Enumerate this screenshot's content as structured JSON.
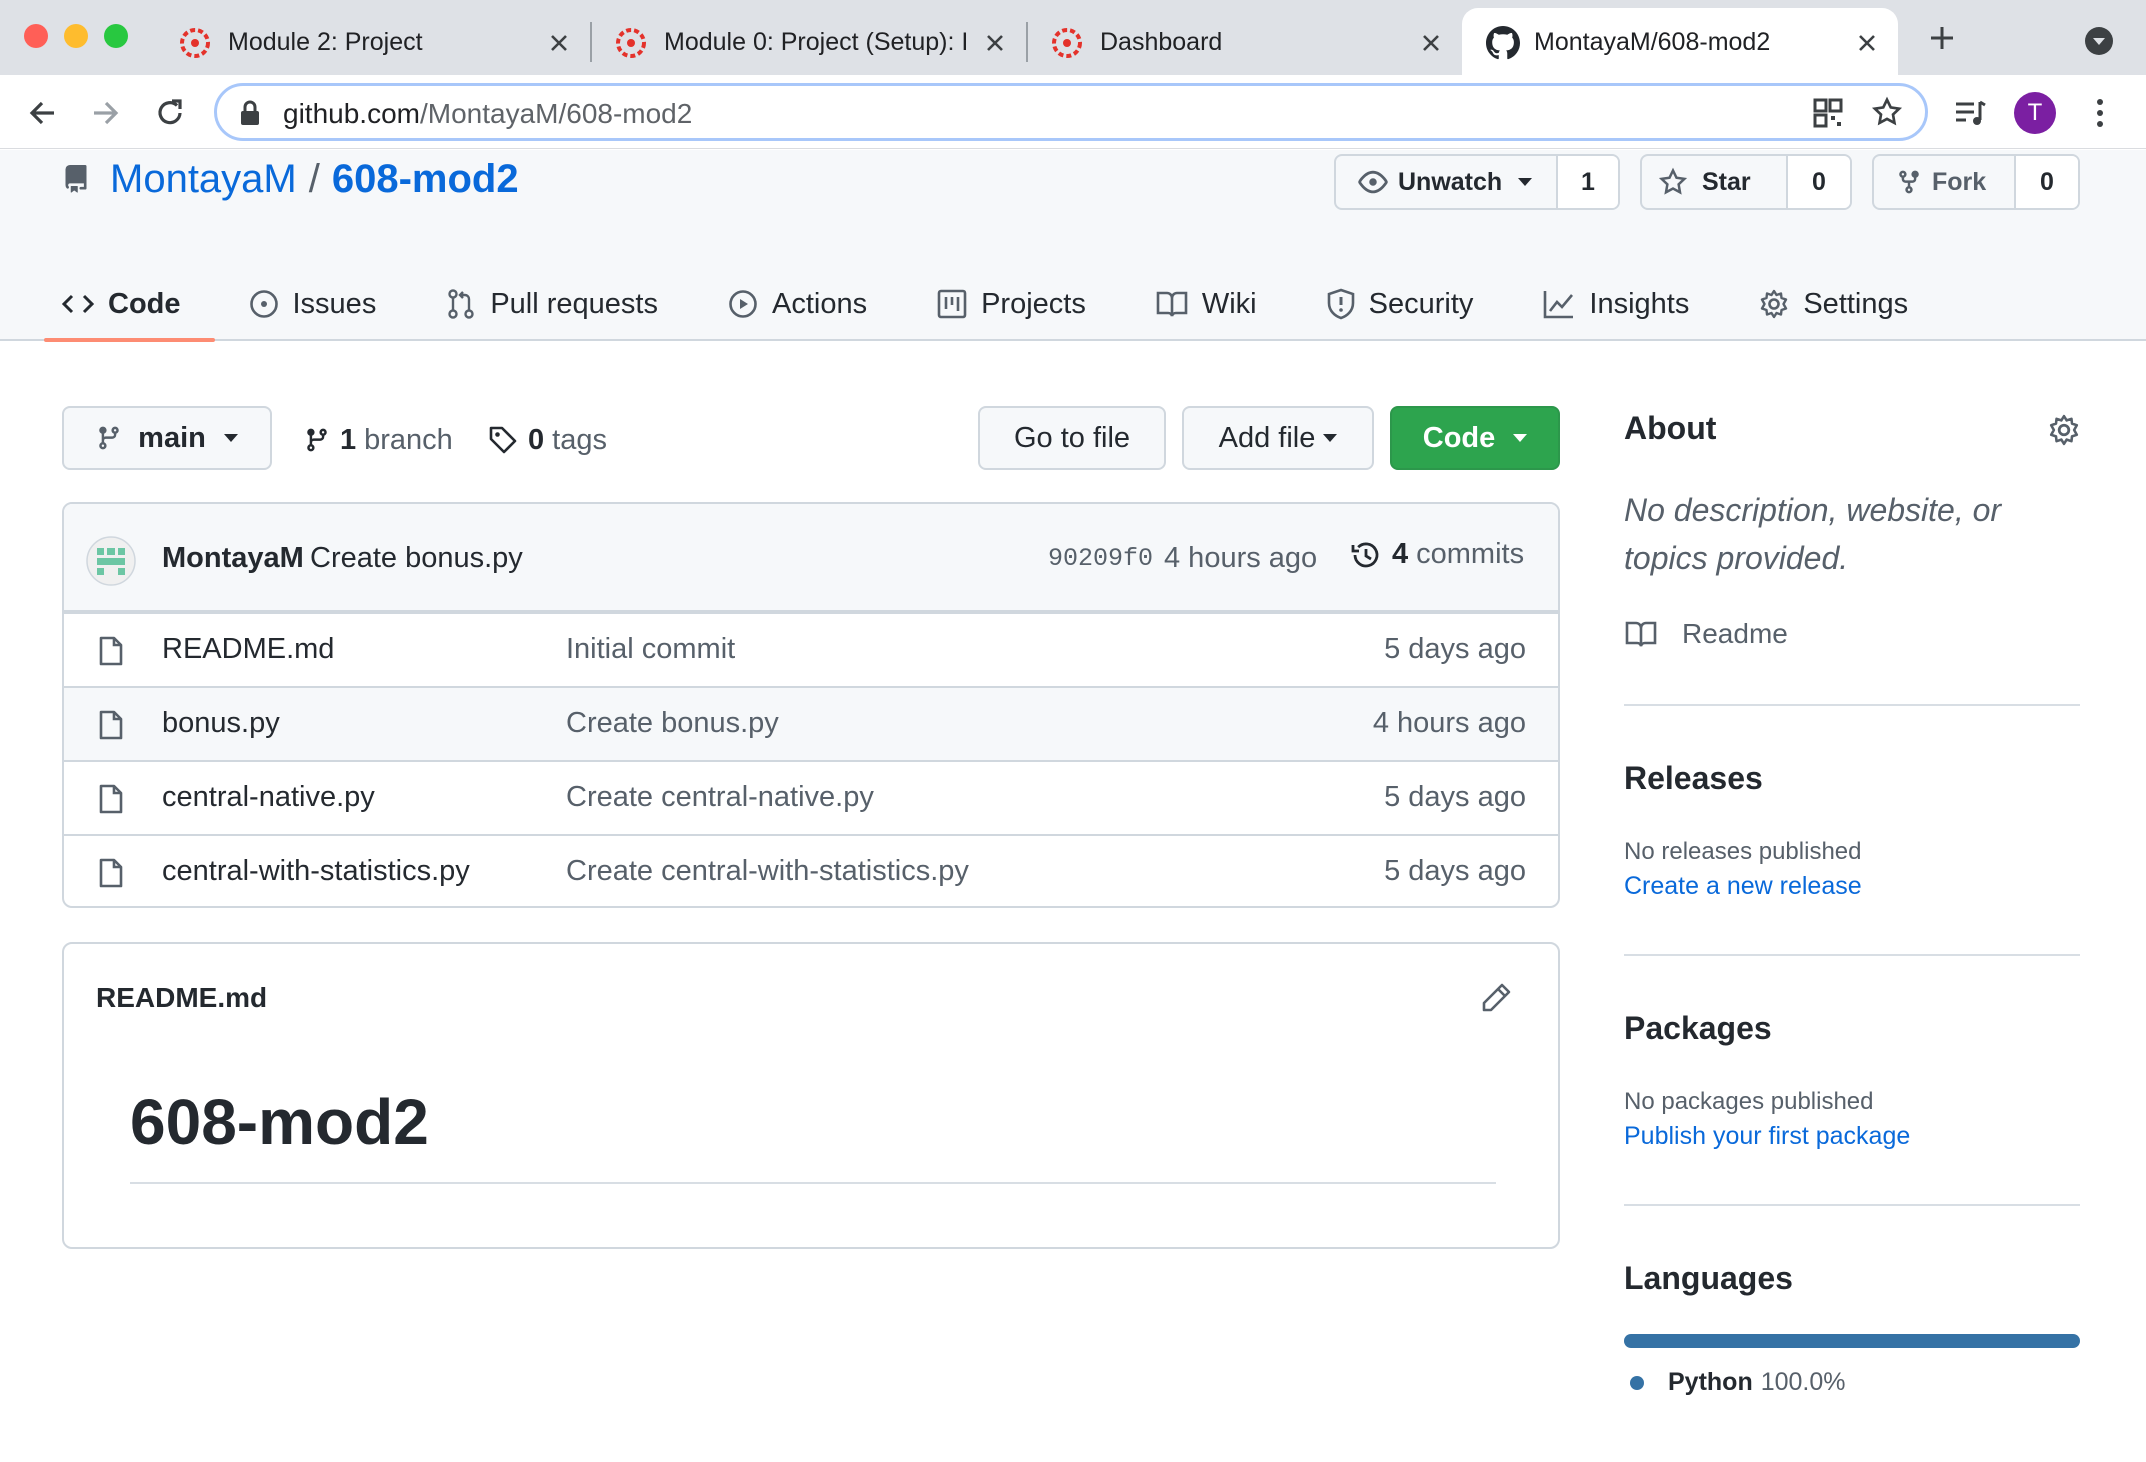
{
  "browser": {
    "tabs": [
      {
        "title": "Module 2: Project",
        "favicon": "canvas-icon"
      },
      {
        "title": "Module 0: Project (Setup): I",
        "favicon": "canvas-icon"
      },
      {
        "title": "Dashboard",
        "favicon": "canvas-icon"
      },
      {
        "title": "MontayaM/608-mod2",
        "favicon": "github-icon",
        "active": true
      }
    ],
    "url_host": "github.com",
    "url_path": "/MontayaM/608-mod2",
    "profile_initial": "T",
    "profile_color": "#7b1fa2"
  },
  "repo": {
    "owner": "MontayaM",
    "separator": "/",
    "name": "608-mod2",
    "watch_label": "Unwatch",
    "watch_count": "1",
    "star_label": "Star",
    "star_count": "0",
    "fork_label": "Fork",
    "fork_count": "0"
  },
  "nav": {
    "code": "Code",
    "issues": "Issues",
    "pulls": "Pull requests",
    "actions": "Actions",
    "projects": "Projects",
    "wiki": "Wiki",
    "security": "Security",
    "insights": "Insights",
    "settings": "Settings",
    "selected": "code"
  },
  "toolbar": {
    "branch": "main",
    "branch_count": "1",
    "branch_label": "branch",
    "tag_count": "0",
    "tag_label": "tags",
    "go_to_file": "Go to file",
    "add_file": "Add file",
    "code": "Code"
  },
  "latest_commit": {
    "author": "MontayaM",
    "message": "Create bonus.py",
    "sha": "90209f0",
    "age": "4 hours ago",
    "commit_count": "4",
    "commit_label": "commits"
  },
  "files": [
    {
      "name": "README.md",
      "message": "Initial commit",
      "age": "5 days ago"
    },
    {
      "name": "bonus.py",
      "message": "Create bonus.py",
      "age": "4 hours ago"
    },
    {
      "name": "central-native.py",
      "message": "Create central-native.py",
      "age": "5 days ago"
    },
    {
      "name": "central-with-statistics.py",
      "message": "Create central-with-statistics.py",
      "age": "5 days ago"
    }
  ],
  "readme": {
    "filename": "README.md",
    "heading": "608-mod2"
  },
  "about": {
    "title": "About",
    "description": "No description, website, or topics provided.",
    "readme_link": "Readme"
  },
  "releases": {
    "title": "Releases",
    "empty": "No releases published",
    "link": "Create a new release"
  },
  "packages": {
    "title": "Packages",
    "empty": "No packages published",
    "link": "Publish your first package"
  },
  "languages": {
    "title": "Languages",
    "items": [
      {
        "name": "Python",
        "percent": "100.0%",
        "color": "#3572A5",
        "fraction": 1.0
      }
    ]
  }
}
